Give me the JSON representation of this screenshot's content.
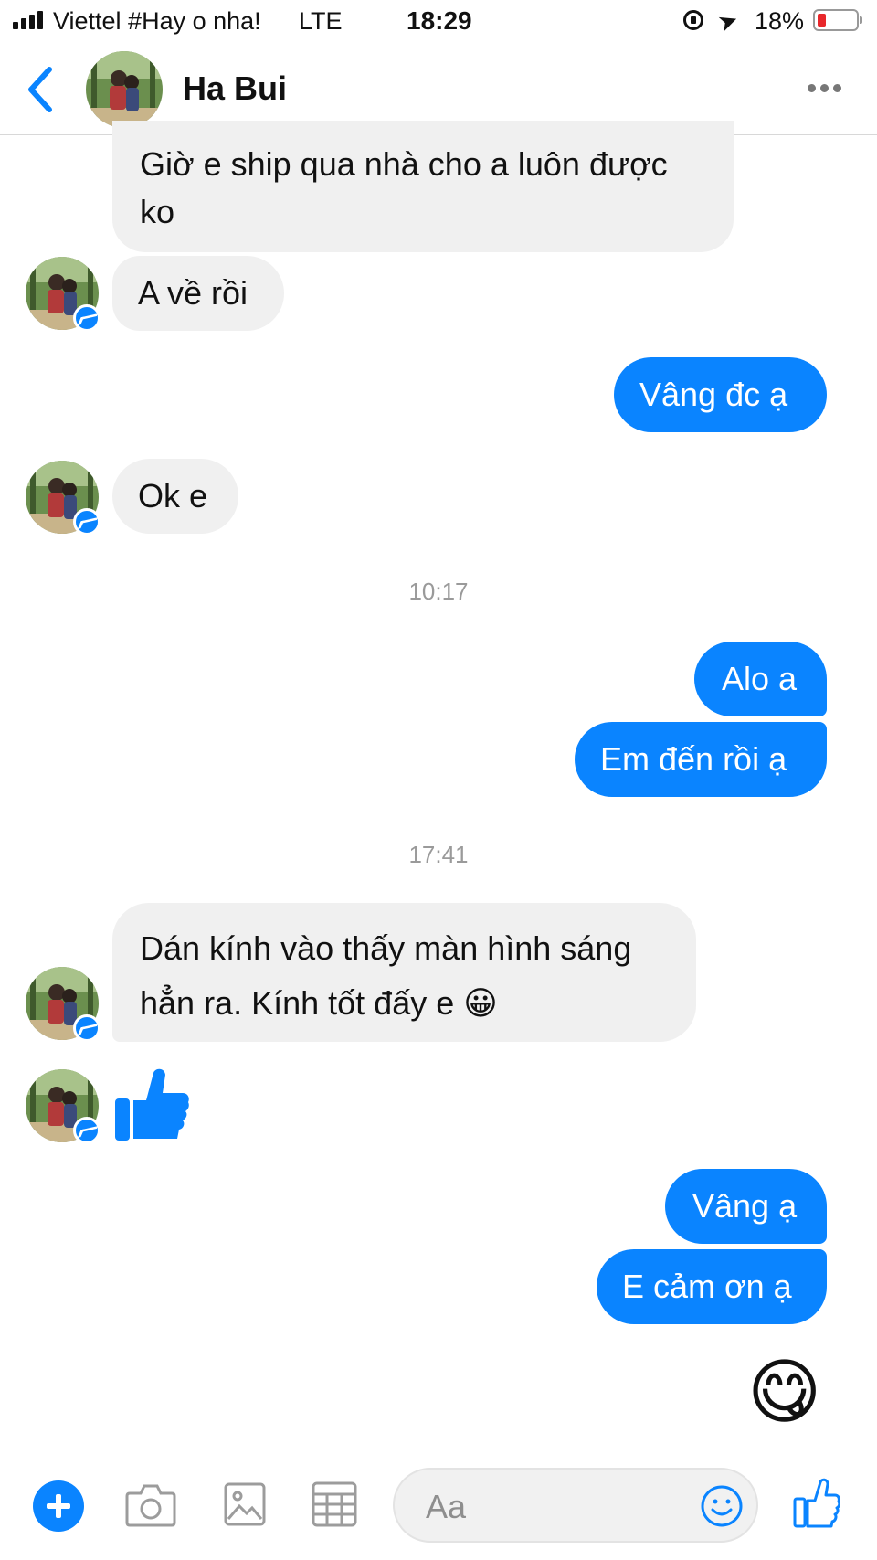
{
  "status_bar": {
    "carrier": "Viettel #Hay o nha!",
    "network": "LTE",
    "time": "18:29",
    "battery": "18%",
    "battery_level": 0.18
  },
  "header": {
    "contact_name": "Ha Bui",
    "back_icon": "chevron-left-icon",
    "more_icon": "more-dots-icon"
  },
  "colors": {
    "accent": "#0a84ff",
    "incoming_bubble": "#f0f0f0",
    "battery_low": "#e8272b"
  },
  "messages": [
    {
      "side": "in",
      "text_line1": "Giờ e ship qua nhà cho a luôn được",
      "text_line2": "ko"
    },
    {
      "side": "in",
      "text": "A về rồi"
    },
    {
      "side": "out",
      "text": "Vâng đc ạ"
    },
    {
      "side": "in",
      "text": "Ok e"
    },
    {
      "timestamp": "10:17"
    },
    {
      "side": "out",
      "text": "Alo a"
    },
    {
      "side": "out",
      "text": "Em đến rồi ạ"
    },
    {
      "timestamp": "17:41"
    },
    {
      "side": "in",
      "text_line1": "Dán kính vào thấy màn hình sáng",
      "text_line2": "hẳn ra. Kính tốt đấy e",
      "emoji": "😀"
    },
    {
      "side": "in",
      "sticker": "thumbs-up-icon"
    },
    {
      "side": "out",
      "text": "Vâng ạ"
    },
    {
      "side": "out",
      "text": "E cảm ơn ạ"
    },
    {
      "side": "out",
      "sticker": "😋"
    }
  ],
  "composer": {
    "placeholder": "Aa",
    "icons": [
      "plus-icon",
      "camera-icon",
      "gallery-icon",
      "grid-icon",
      "smile-icon",
      "like-icon"
    ]
  }
}
